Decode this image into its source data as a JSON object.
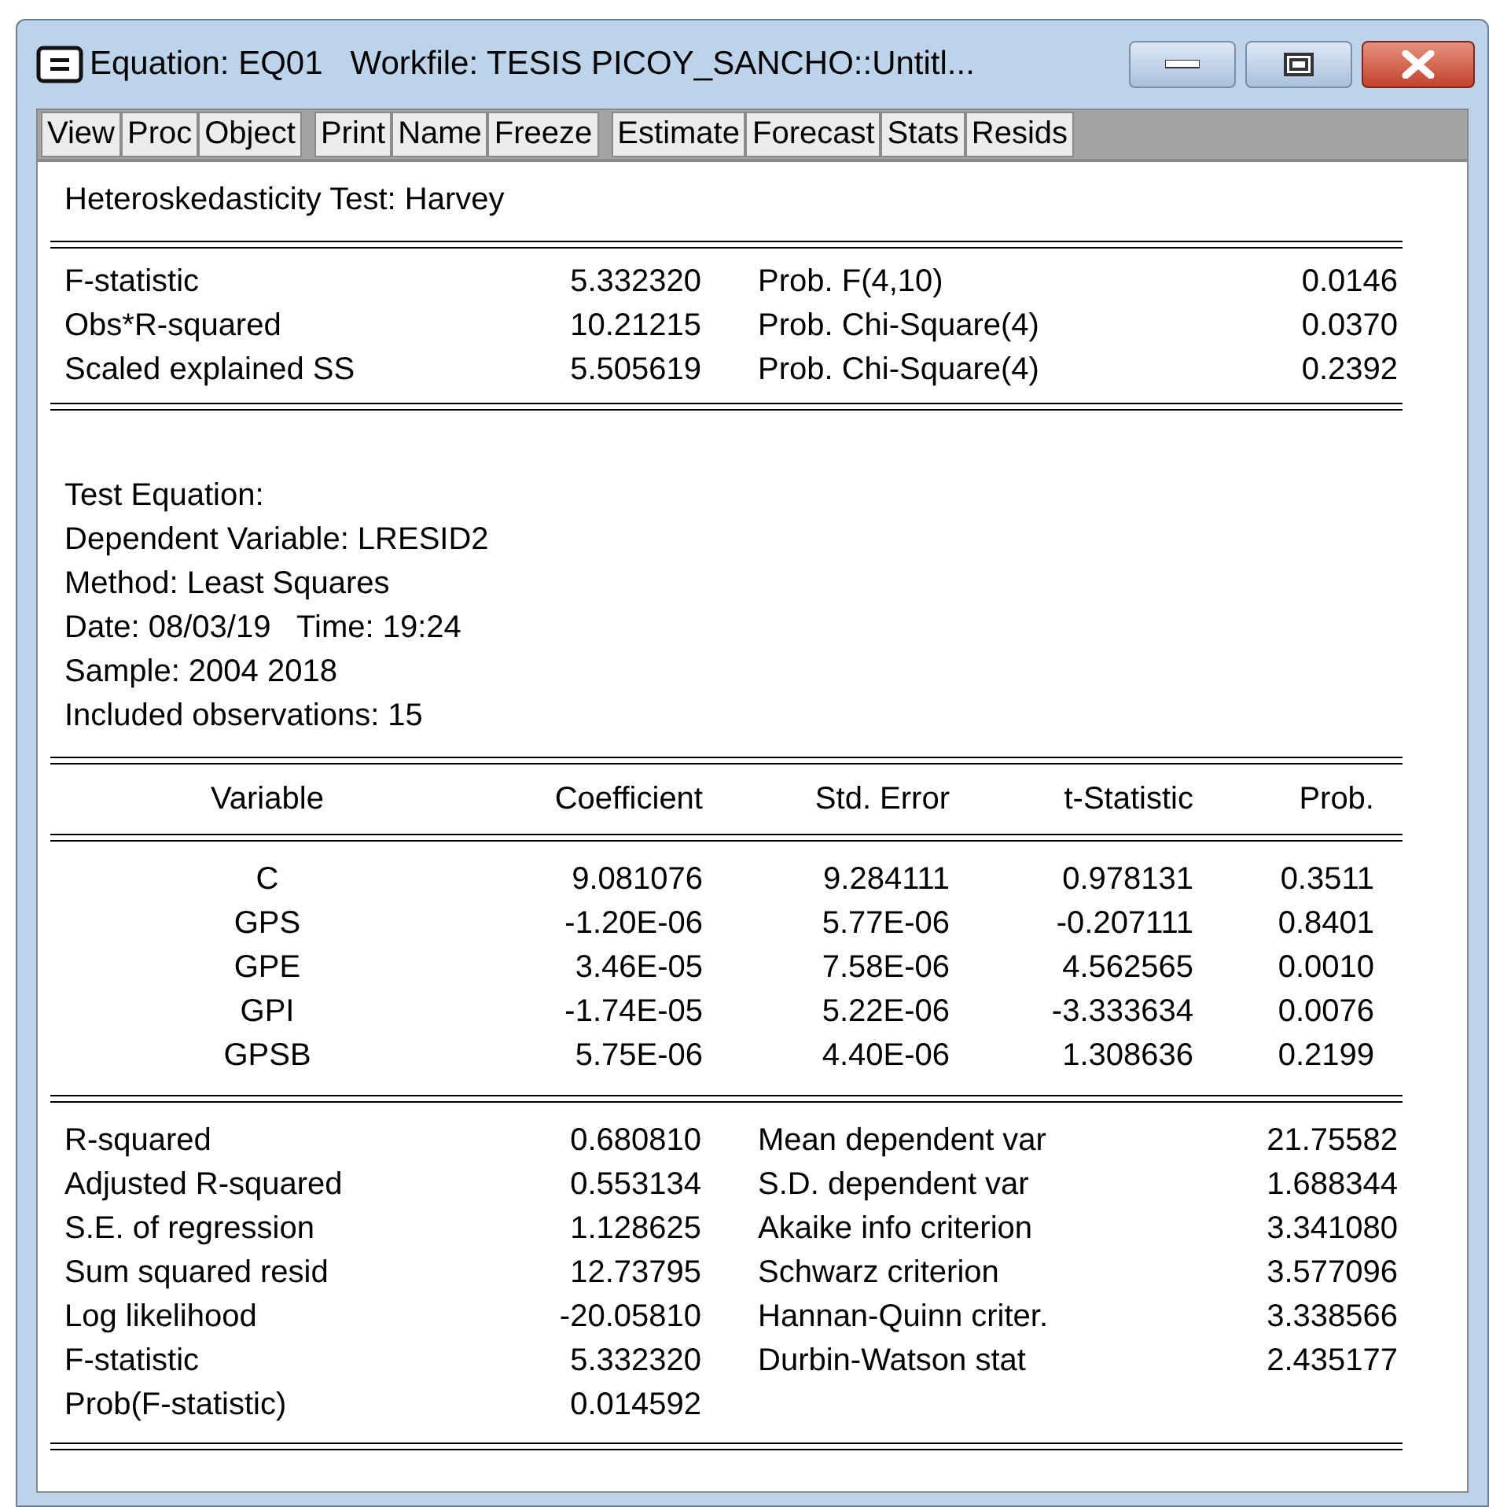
{
  "window": {
    "title": "Equation: EQ01   Workfile: TESIS PICOY_SANCHO::Untitl..."
  },
  "toolbar": {
    "groups": [
      [
        "View",
        "Proc",
        "Object"
      ],
      [
        "Print",
        "Name",
        "Freeze"
      ],
      [
        "Estimate",
        "Forecast",
        "Stats",
        "Resids"
      ]
    ]
  },
  "output": {
    "heading": "Heteroskedasticity Test: Harvey",
    "test_stats": [
      [
        "F-statistic",
        "5.332320",
        "Prob. F(4,10)",
        "0.0146"
      ],
      [
        "Obs*R-squared",
        "10.21215",
        "Prob. Chi-Square(4)",
        "0.0370"
      ],
      [
        "Scaled explained SS",
        "5.505619",
        "Prob. Chi-Square(4)",
        "0.2392"
      ]
    ],
    "info": [
      "Test Equation:",
      "Dependent Variable: LRESID2",
      "Method: Least Squares",
      "Date: 08/03/19   Time: 19:24",
      "Sample: 2004 2018",
      "Included observations: 15"
    ],
    "coefficients": {
      "columns": [
        "Variable",
        "Coefficient",
        "Std. Error",
        "t-Statistic",
        "Prob."
      ],
      "rows": [
        [
          "C",
          "9.081076",
          "9.284111",
          "0.978131",
          "0.3511"
        ],
        [
          "GPS",
          "-1.20E-06",
          "5.77E-06",
          "-0.207111",
          "0.8401"
        ],
        [
          "GPE",
          "3.46E-05",
          "7.58E-06",
          "4.562565",
          "0.0010"
        ],
        [
          "GPI",
          "-1.74E-05",
          "5.22E-06",
          "-3.333634",
          "0.0076"
        ],
        [
          "GPSB",
          "5.75E-06",
          "4.40E-06",
          "1.308636",
          "0.2199"
        ]
      ]
    },
    "summary": [
      [
        "R-squared",
        "0.680810",
        "Mean dependent var",
        "21.75582"
      ],
      [
        "Adjusted R-squared",
        "0.553134",
        "S.D. dependent var",
        "1.688344"
      ],
      [
        "S.E. of regression",
        "1.128625",
        "Akaike info criterion",
        "3.341080"
      ],
      [
        "Sum squared resid",
        "12.73795",
        "Schwarz criterion",
        "3.577096"
      ],
      [
        "Log likelihood",
        "-20.05810",
        "Hannan-Quinn criter.",
        "3.338566"
      ],
      [
        "F-statistic",
        "5.332320",
        "Durbin-Watson stat",
        "2.435177"
      ],
      [
        "Prob(F-statistic)",
        "0.014592"
      ]
    ]
  }
}
